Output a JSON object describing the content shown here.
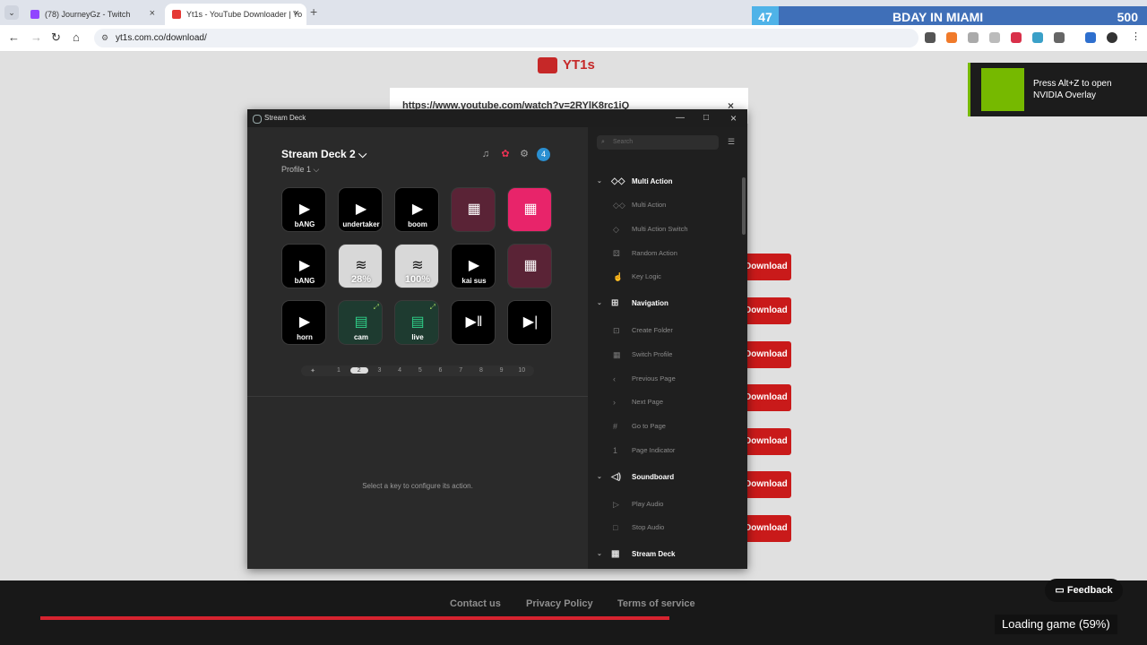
{
  "browser": {
    "tabs": [
      {
        "title": "(78) JourneyGz - Twitch",
        "color": "#9146ff"
      },
      {
        "title": "Yt1s - YouTube Downloader | Yo",
        "color": "#e53935"
      }
    ],
    "url": "yt1s.com.co/download/"
  },
  "overlay": {
    "count": "47",
    "title": "BDAY IN MIAMI",
    "value": "500"
  },
  "page": {
    "logo": "YT1s",
    "input_url": "https://www.youtube.com/watch?v=2RYlK8rc1iQ",
    "download_label": "Download",
    "footer_links": [
      "Contact us",
      "Privacy Policy",
      "Terms of service"
    ],
    "feedback": "Feedback",
    "loading": "Loading game (59%)"
  },
  "nvidia": {
    "message": "Press Alt+Z to open NVIDIA Overlay"
  },
  "streamdeck": {
    "window_title": "Stream Deck",
    "device": "Stream Deck 2",
    "device_chevron": "⌵",
    "profile": "Profile 1",
    "profile_chevron": "⌵",
    "notification_count": "4",
    "keys": [
      {
        "label": "bANG",
        "type": "video"
      },
      {
        "label": "undertaker",
        "type": "video"
      },
      {
        "label": "boom",
        "type": "video"
      },
      {
        "label": "",
        "type": "grid"
      },
      {
        "label": "",
        "type": "gridhot"
      },
      {
        "label": "bANG",
        "type": "video"
      },
      {
        "label": "28%",
        "type": "spotify"
      },
      {
        "label": "100%",
        "type": "spotify"
      },
      {
        "label": "kai sus",
        "type": "video"
      },
      {
        "label": "",
        "type": "grid"
      },
      {
        "label": "horn",
        "type": "video"
      },
      {
        "label": "cam",
        "type": "green"
      },
      {
        "label": "live",
        "type": "green"
      },
      {
        "label": "",
        "type": "playpause"
      },
      {
        "label": "",
        "type": "next"
      }
    ],
    "pages": [
      "1",
      "2",
      "3",
      "4",
      "5",
      "6",
      "7",
      "8",
      "9",
      "10"
    ],
    "hint": "Select a key to configure its action.",
    "search_placeholder": "Search",
    "actions": [
      {
        "kind": "cat",
        "label": "Multi Action",
        "icon": "multi-action-icon"
      },
      {
        "kind": "item",
        "label": "Multi Action",
        "icon": "multi-action-icon"
      },
      {
        "kind": "item",
        "label": "Multi Action Switch",
        "icon": "multi-action-switch-icon"
      },
      {
        "kind": "item",
        "label": "Random Action",
        "icon": "random-action-icon"
      },
      {
        "kind": "item",
        "label": "Key Logic",
        "icon": "key-logic-icon"
      },
      {
        "kind": "cat",
        "label": "Navigation",
        "icon": "navigation-icon"
      },
      {
        "kind": "item",
        "label": "Create Folder",
        "icon": "folder-icon"
      },
      {
        "kind": "item",
        "label": "Switch Profile",
        "icon": "switch-profile-icon"
      },
      {
        "kind": "item",
        "label": "Previous Page",
        "icon": "previous-page-icon"
      },
      {
        "kind": "item",
        "label": "Next Page",
        "icon": "next-page-icon"
      },
      {
        "kind": "item",
        "label": "Go to Page",
        "icon": "go-to-page-icon"
      },
      {
        "kind": "item",
        "label": "Page Indicator",
        "icon": "page-indicator-icon"
      },
      {
        "kind": "cat",
        "label": "Soundboard",
        "icon": "speaker-icon"
      },
      {
        "kind": "item",
        "label": "Play Audio",
        "icon": "play-audio-icon"
      },
      {
        "kind": "item",
        "label": "Stop Audio",
        "icon": "stop-audio-icon"
      },
      {
        "kind": "cat",
        "label": "Stream Deck",
        "icon": "stream-deck-icon"
      }
    ]
  }
}
